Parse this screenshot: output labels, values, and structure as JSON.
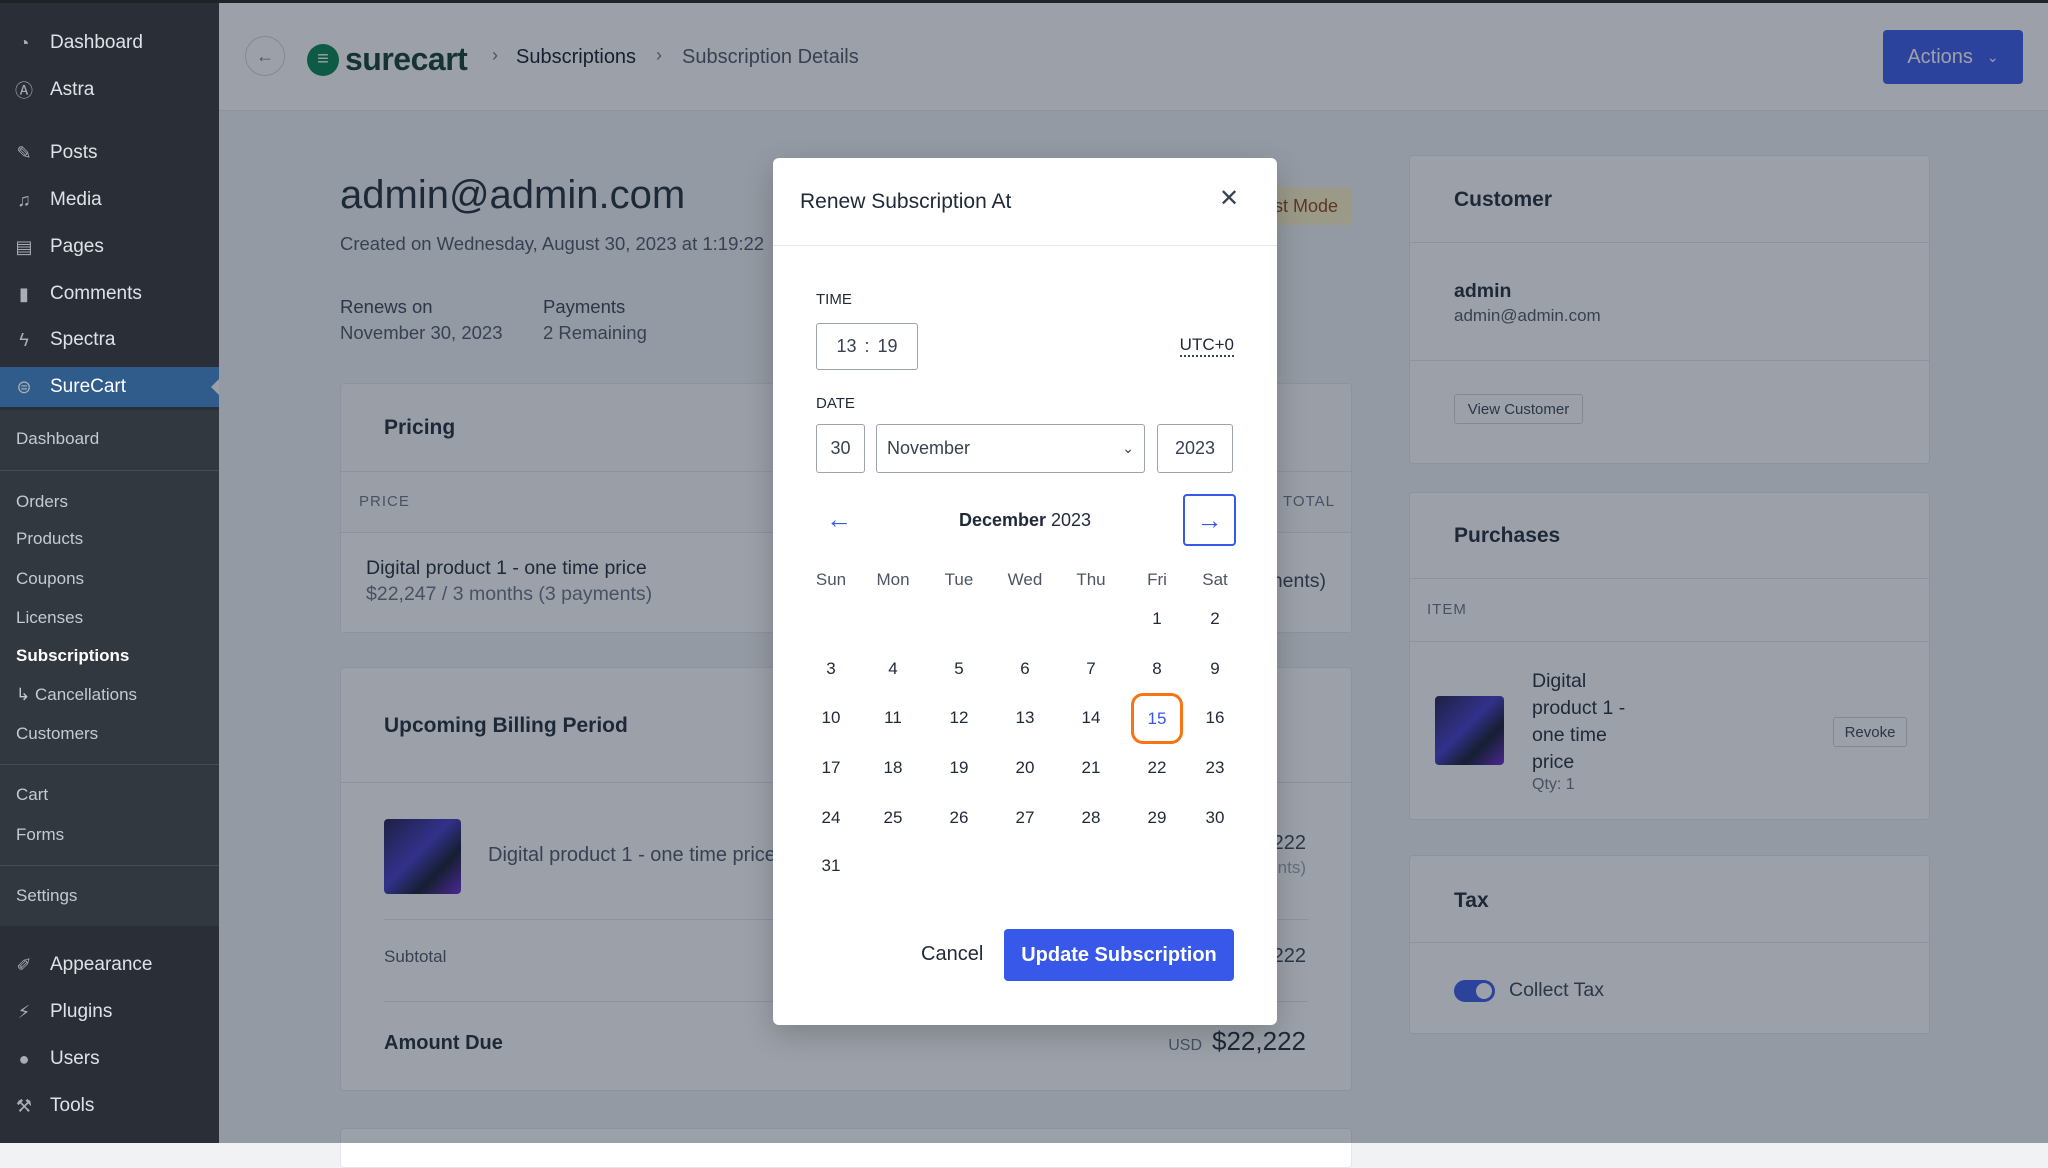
{
  "sidebar": {
    "items": [
      {
        "label": "Dashboard",
        "icon": "dashboard-icon",
        "glyph": "◔"
      },
      {
        "label": "Astra",
        "icon": "astra-icon",
        "glyph": "Ⓐ"
      },
      {
        "label": "Posts",
        "icon": "pin-icon",
        "glyph": "✎"
      },
      {
        "label": "Media",
        "icon": "media-icon",
        "glyph": "♫"
      },
      {
        "label": "Pages",
        "icon": "pages-icon",
        "glyph": "▤"
      },
      {
        "label": "Comments",
        "icon": "comment-icon",
        "glyph": "▮"
      },
      {
        "label": "Spectra",
        "icon": "spectra-icon",
        "glyph": "ϟ"
      },
      {
        "label": "SureCart",
        "icon": "surecart-icon",
        "glyph": "⊜"
      },
      {
        "label": "Appearance",
        "icon": "brush-icon",
        "glyph": "✐"
      },
      {
        "label": "Plugins",
        "icon": "plugin-icon",
        "glyph": "⚡"
      },
      {
        "label": "Users",
        "icon": "user-icon",
        "glyph": "●"
      },
      {
        "label": "Tools",
        "icon": "wrench-icon",
        "glyph": "⚒"
      }
    ],
    "submenu": [
      "Dashboard",
      "Orders",
      "Products",
      "Coupons",
      "Licenses",
      "Subscriptions",
      "↳ Cancellations",
      "Customers",
      "Cart",
      "Forms",
      "Settings"
    ]
  },
  "header": {
    "logo": "surecart",
    "breadcrumb": [
      "Subscriptions",
      "Subscription Details"
    ],
    "actions_label": "Actions"
  },
  "main": {
    "title": "admin@admin.com",
    "created": "Created on Wednesday, August 30, 2023 at 1:19:22",
    "badge": "Test Mode",
    "renews_label": "Renews on",
    "renews_value": "November 30, 2023",
    "payments_label": "Payments",
    "payments_value": "2 Remaining",
    "pricing": {
      "title": "Pricing",
      "col_price": "PRICE",
      "col_total": "TOTAL",
      "item_name": "Digital product 1 - one time price",
      "item_detail": "$22,247 / 3 months (3 payments)",
      "item_total_note": "(3 payments)"
    },
    "billing": {
      "title": "Upcoming Billing Period",
      "item_name": "Digital product 1 - one time price",
      "item_amount": "$22,222",
      "item_note": "(3 payments)",
      "subtotal_label": "Subtotal",
      "subtotal_value": "$22,222",
      "amount_due_label": "Amount Due",
      "currency": "USD",
      "amount_due_value": "$22,222"
    }
  },
  "right": {
    "customer": {
      "title": "Customer",
      "name": "admin",
      "email": "admin@admin.com",
      "button": "View Customer"
    },
    "purchases": {
      "title": "Purchases",
      "col_item": "ITEM",
      "item_lines": [
        "Digital",
        "product 1 -",
        "one time",
        "price"
      ],
      "qty": "Qty: 1",
      "revoke": "Revoke"
    },
    "tax": {
      "title": "Tax",
      "toggle_label": "Collect Tax",
      "toggle_on": true
    }
  },
  "modal": {
    "title": "Renew Subscription At",
    "time_label": "TIME",
    "hour": "13",
    "minute": "19",
    "timezone": "UTC+0",
    "date_label": "DATE",
    "day": "30",
    "month": "November",
    "year": "2023",
    "calendar_month": "December",
    "calendar_year": "2023",
    "weekdays": [
      "Sun",
      "Mon",
      "Tue",
      "Wed",
      "Thu",
      "Fri",
      "Sat"
    ],
    "first_weekday": 5,
    "days_in_month": 31,
    "selected_day": 15,
    "cancel": "Cancel",
    "submit": "Update Subscription"
  },
  "colors": {
    "accent": "#3858e9",
    "selected_ring": "#f97316",
    "brand_green": "#01824c"
  }
}
